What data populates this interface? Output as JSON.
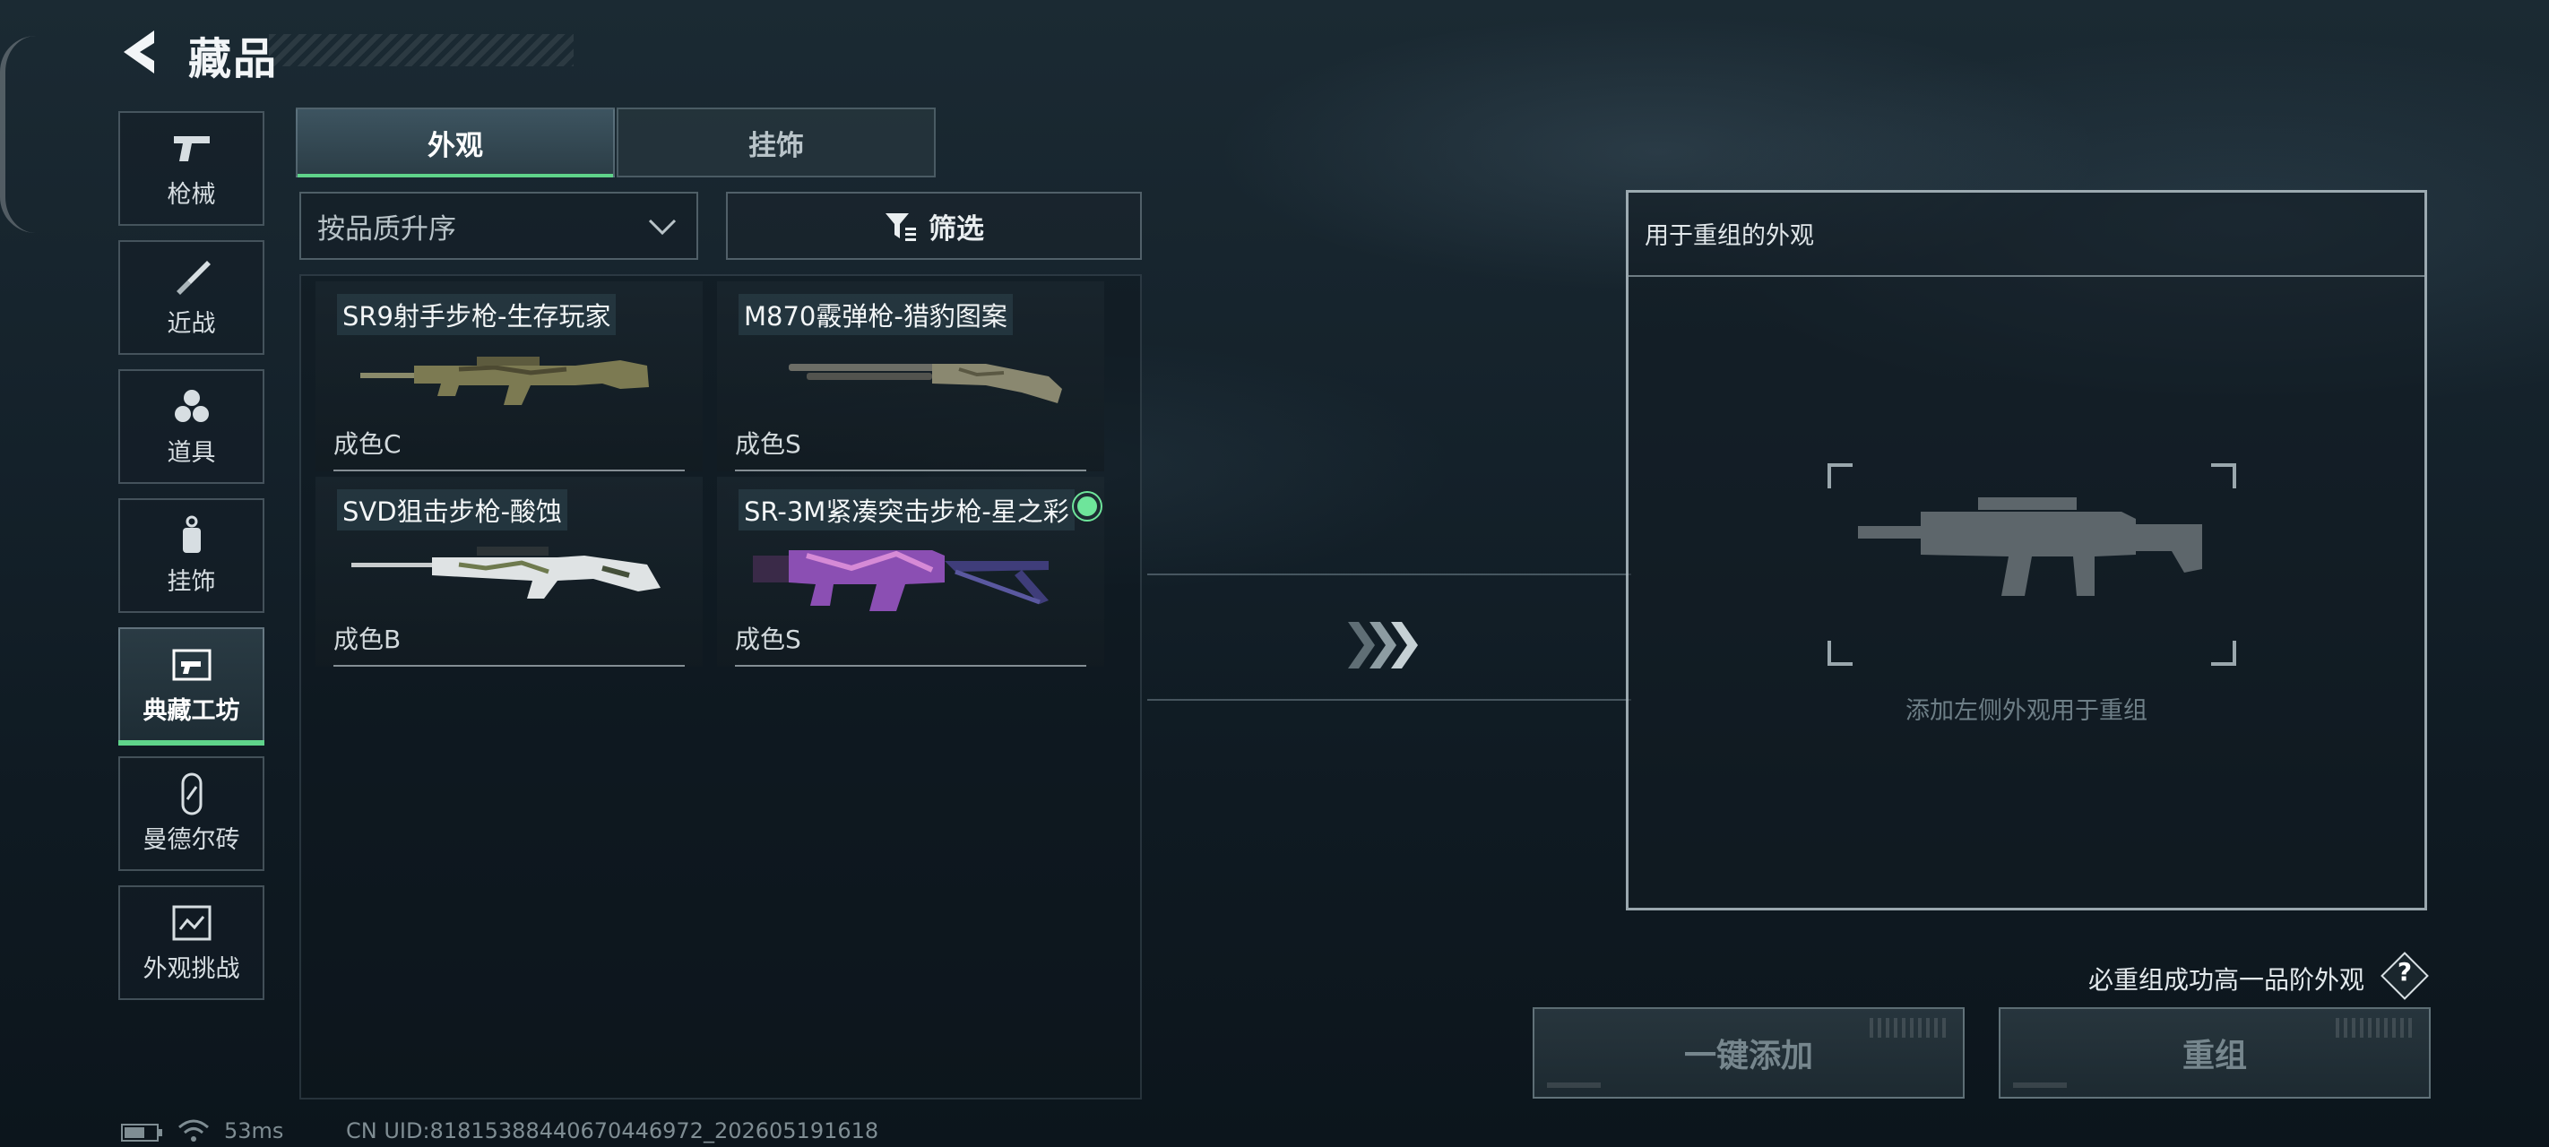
{
  "header": {
    "title": "藏品",
    "back_icon": "back-arrow-icon"
  },
  "sidebar": {
    "items": [
      {
        "label": "枪械",
        "icon": "pistol-icon"
      },
      {
        "label": "近战",
        "icon": "knife-icon"
      },
      {
        "label": "道具",
        "icon": "grenade-icon"
      },
      {
        "label": "挂饰",
        "icon": "charm-icon"
      },
      {
        "label": "典藏工坊",
        "icon": "workshop-icon",
        "active": true
      },
      {
        "label": "曼德尔砖",
        "icon": "brick-icon"
      },
      {
        "label": "外观挑战",
        "icon": "challenge-icon"
      }
    ]
  },
  "tabs": [
    {
      "label": "外观",
      "active": true
    },
    {
      "label": "挂饰",
      "active": false
    }
  ],
  "sort": {
    "value": "按品质升序"
  },
  "filter": {
    "label": "筛选"
  },
  "items": [
    {
      "name": "SR9射手步枪-生存玩家",
      "grade": "成色C"
    },
    {
      "name": "M870霰弹枪-猎豹图案",
      "grade": "成色S"
    },
    {
      "name": "SVD狙击步枪-酸蚀",
      "grade": "成色B"
    },
    {
      "name": "SR-3M紧凑突击步枪-星之彩",
      "grade": "成色S",
      "equipped": true
    }
  ],
  "recombine": {
    "panel_title": "用于重组的外观",
    "empty_hint": "添加左侧外观用于重组",
    "guarantee_text": "必重组成功高一品阶外观",
    "help_label": "?",
    "add_all_label": "一键添加",
    "recombine_label": "重组"
  },
  "status": {
    "ping": "53ms",
    "uid": "CN UID:8181538844067044697​2_202605191618"
  },
  "colors": {
    "accent": "#5fd38a",
    "equipped": "#6ee59b"
  }
}
